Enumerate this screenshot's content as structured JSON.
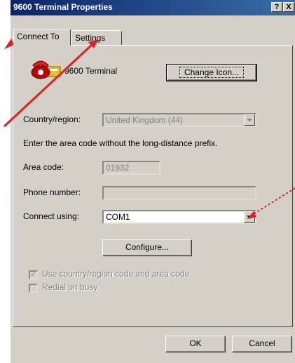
{
  "window": {
    "title": "9600 Terminal Properties",
    "help_btn": "?",
    "close_btn": "X"
  },
  "tabs": [
    {
      "label": "Connect To"
    },
    {
      "label": "Settings"
    }
  ],
  "connection": {
    "name": "9600 Terminal",
    "change_icon_label": "Change Icon..."
  },
  "country": {
    "label": "Country/region:",
    "value": "United Kingdom (44)"
  },
  "hint": "Enter the area code without the long-distance prefix.",
  "area_code": {
    "label": "Area code:",
    "value": "01932"
  },
  "phone": {
    "label": "Phone number:",
    "value": ""
  },
  "connect_using": {
    "label": "Connect using:",
    "value": "COM1"
  },
  "configure_label": "Configure...",
  "checkboxes": {
    "use_codes": {
      "label": "Use country/region code and area code",
      "checked": true
    },
    "redial": {
      "label": "Redial on busy",
      "checked": false
    }
  },
  "footer": {
    "ok": "OK",
    "cancel": "Cancel"
  },
  "colors": {
    "annotation": "#e02020",
    "title_start": "#0a246a",
    "title_end": "#3a6ea5"
  }
}
